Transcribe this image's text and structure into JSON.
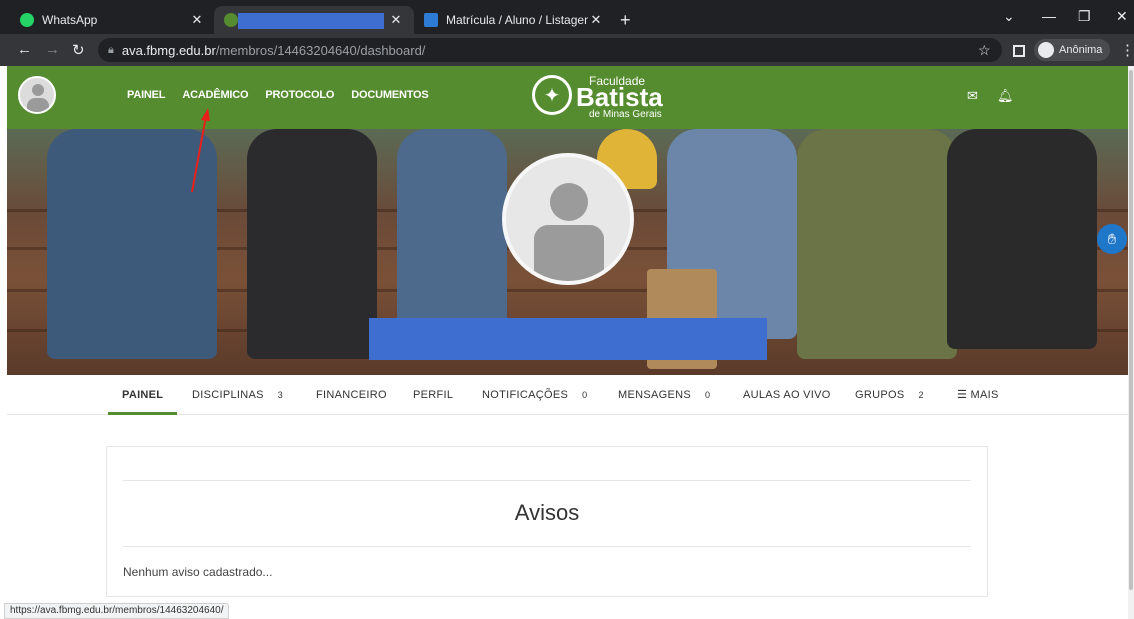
{
  "browser": {
    "tabs": [
      {
        "title": "WhatsApp",
        "favicon_color": "#25d366"
      },
      {
        "title": "",
        "favicon_color": "#558c2f",
        "redacted": true
      },
      {
        "title": "Matrícula / Aluno / Listagem - Si",
        "favicon_color": "#2e7bd6"
      }
    ],
    "new_tab": "+",
    "url_host": "ava.fbmg.edu.br",
    "url_path": "/membros/14463204640/dashboard/",
    "profile_label": "Anônima",
    "status_url": "https://ava.fbmg.edu.br/membros/14463204640/"
  },
  "header": {
    "nav": [
      "PAINEL",
      "ACADÊMICO",
      "PROTOCOLO",
      "DOCUMENTOS"
    ],
    "logo": {
      "top": "Faculdade",
      "main": "Batista",
      "sub": "de Minas Gerais"
    },
    "brand_color": "#558c2f"
  },
  "profile_tabs": [
    {
      "label": "PAINEL",
      "count": ""
    },
    {
      "label": "DISCIPLINAS",
      "count": "3"
    },
    {
      "label": "FINANCEIRO",
      "count": ""
    },
    {
      "label": "PERFIL",
      "count": ""
    },
    {
      "label": "NOTIFICAÇÕES",
      "count": "0"
    },
    {
      "label": "MENSAGENS",
      "count": "0"
    },
    {
      "label": "AULAS AO VIVO",
      "count": ""
    },
    {
      "label": "GRUPOS",
      "count": "2"
    },
    {
      "label": "☰ MAIS",
      "count": ""
    }
  ],
  "notices": {
    "title": "Avisos",
    "empty": "Nenhum aviso cadastrado..."
  }
}
